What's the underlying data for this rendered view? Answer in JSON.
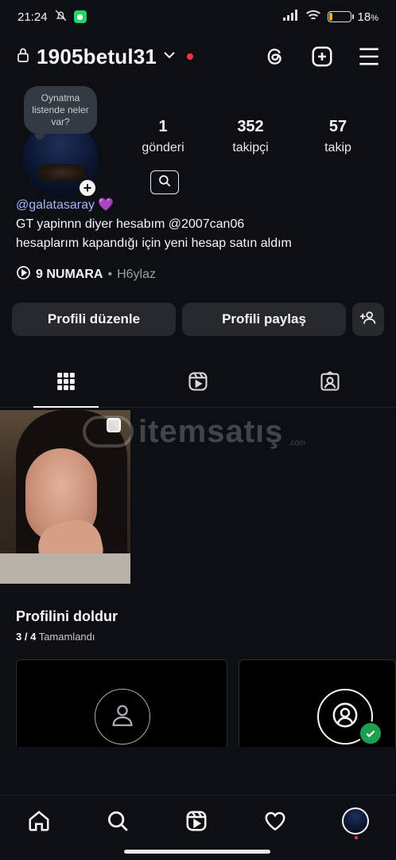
{
  "status_bar": {
    "time": "21:24",
    "battery": "18",
    "battery_unit": "%",
    "battery_level": 0.18
  },
  "header": {
    "username": "1905betul31"
  },
  "profile": {
    "note": "Oynatma listende neler var?",
    "stats": [
      {
        "value": "1",
        "label": "gönderi"
      },
      {
        "value": "352",
        "label": "takipçi"
      },
      {
        "value": "57",
        "label": "takip"
      }
    ],
    "bio_link": "@galatasaray",
    "bio_emoji": "💜",
    "bio_lines": [
      "GT yapinnn diyer hesabım @2007can06",
      "hesaplarım kapandığı için yeni hesap satın aldım"
    ],
    "music_title": "9 NUMARA",
    "music_separator": "•",
    "music_artist": "H6ylaz"
  },
  "buttons": {
    "edit_profile": "Profili düzenle",
    "share_profile": "Profili paylaş"
  },
  "watermark": {
    "text": "itemsatış",
    "suffix": ".com"
  },
  "complete_profile": {
    "title": "Profilini doldur",
    "progress": "3 / 4",
    "progress_label": "Tamamlandı"
  },
  "colors": {
    "background": "#0c1014",
    "button": "#25292e",
    "link": "#a5b3ff",
    "notification": "#ff3040",
    "success": "#1e9f4f"
  },
  "icons": [
    "lock-icon",
    "chevron-down-icon",
    "threads-icon",
    "create-icon",
    "menu-icon",
    "grid-icon",
    "reels-icon",
    "tagged-icon",
    "home-icon",
    "search-icon",
    "heart-icon",
    "add-person-icon"
  ]
}
